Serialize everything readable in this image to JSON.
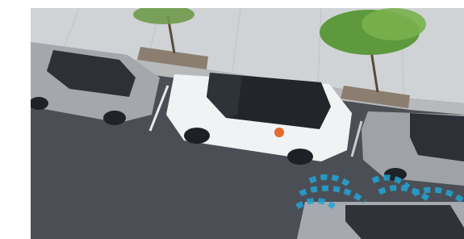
{
  "scene": {
    "subject": "white-suv-parallel-parking",
    "emblem": "kia-style-badge",
    "colors": {
      "asphalt": "#4b4f55",
      "sidewalk": "#cfd3d6",
      "planter": "#8b7e70",
      "curb": "#b7b9bb",
      "white_car": "#f1f2f4",
      "silver_car": "#a4a8ae",
      "sensor_waves": "#21a5d7",
      "accent": "#e46b2c"
    }
  }
}
